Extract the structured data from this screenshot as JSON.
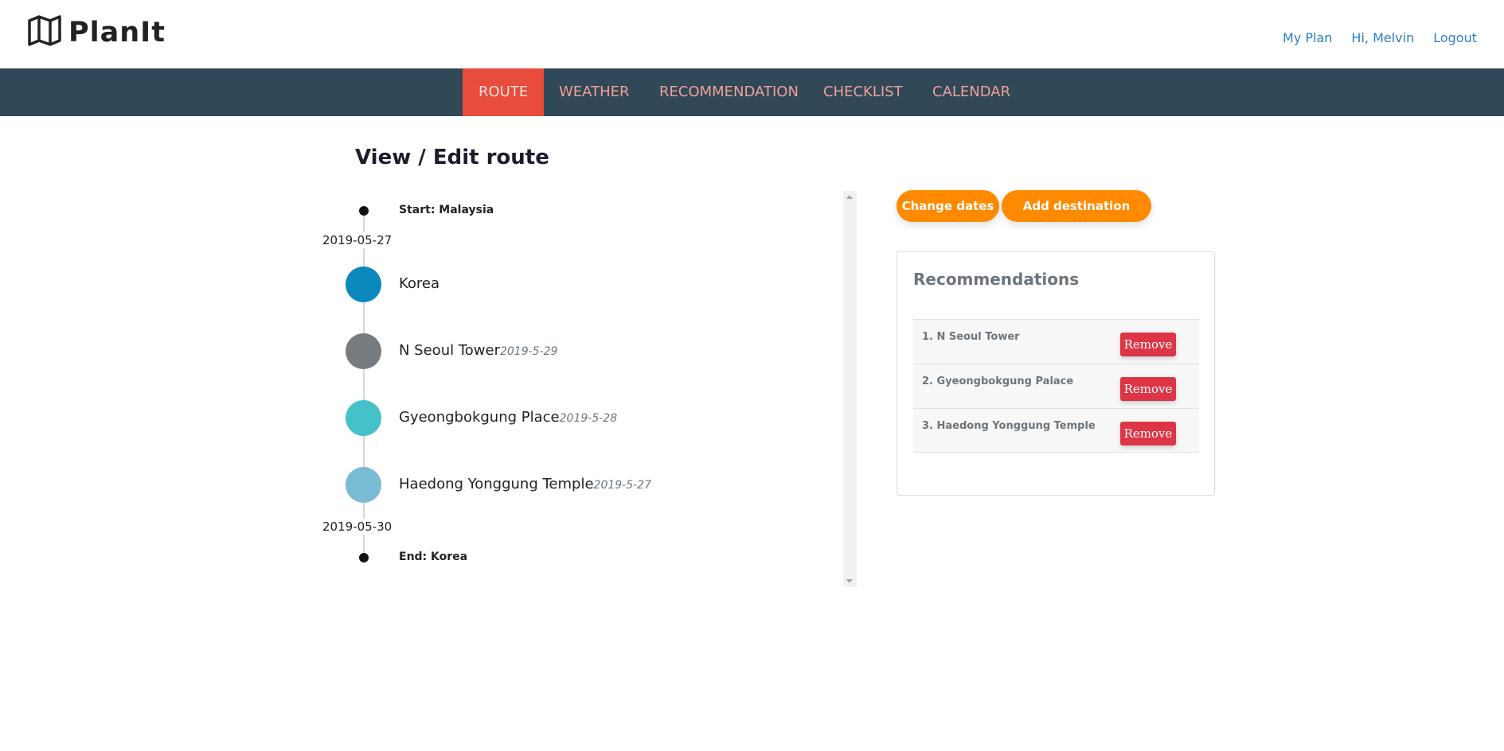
{
  "app": {
    "title": "PlanIt"
  },
  "topnav": {
    "my_plan": "My Plan",
    "greeting": "Hi, Melvin",
    "logout": "Logout"
  },
  "tabs": [
    {
      "label": "ROUTE",
      "active": true
    },
    {
      "label": "WEATHER",
      "active": false
    },
    {
      "label": "RECOMMENDATION",
      "active": false
    },
    {
      "label": "CHECKLIST",
      "active": false
    },
    {
      "label": "CALENDAR",
      "active": false
    }
  ],
  "page": {
    "title": "View / Edit route"
  },
  "route": {
    "start": "Start: Malaysia",
    "start_date": "2019-05-27",
    "stops": [
      {
        "name": "Korea",
        "date": "",
        "color": "#0b89bf"
      },
      {
        "name": "N Seoul Tower",
        "date": "2019-5-29",
        "color": "#767b80"
      },
      {
        "name": "Gyeongbokgung Place",
        "date": "2019-5-28",
        "color": "#45c2c9"
      },
      {
        "name": "Haedong Yonggung Temple",
        "date": "2019-5-27",
        "color": "#79bcd3"
      }
    ],
    "end_date": "2019-05-30",
    "end": "End: Korea"
  },
  "actions": {
    "change_dates": "Change dates",
    "add_destination": "Add destination"
  },
  "recommendations": {
    "title": "Recommendations",
    "items": [
      {
        "label": "1. N Seoul Tower",
        "remove": "Remove"
      },
      {
        "label": "2. Gyeongbokgung Palace",
        "remove": "Remove"
      },
      {
        "label": "3. Haedong Yonggung Temple",
        "remove": "Remove"
      }
    ]
  },
  "colors": {
    "accent": "#e74c3c",
    "navbar": "#304857",
    "button": "#ff8a00",
    "danger": "#dc3545",
    "link": "#2c7fc4"
  }
}
